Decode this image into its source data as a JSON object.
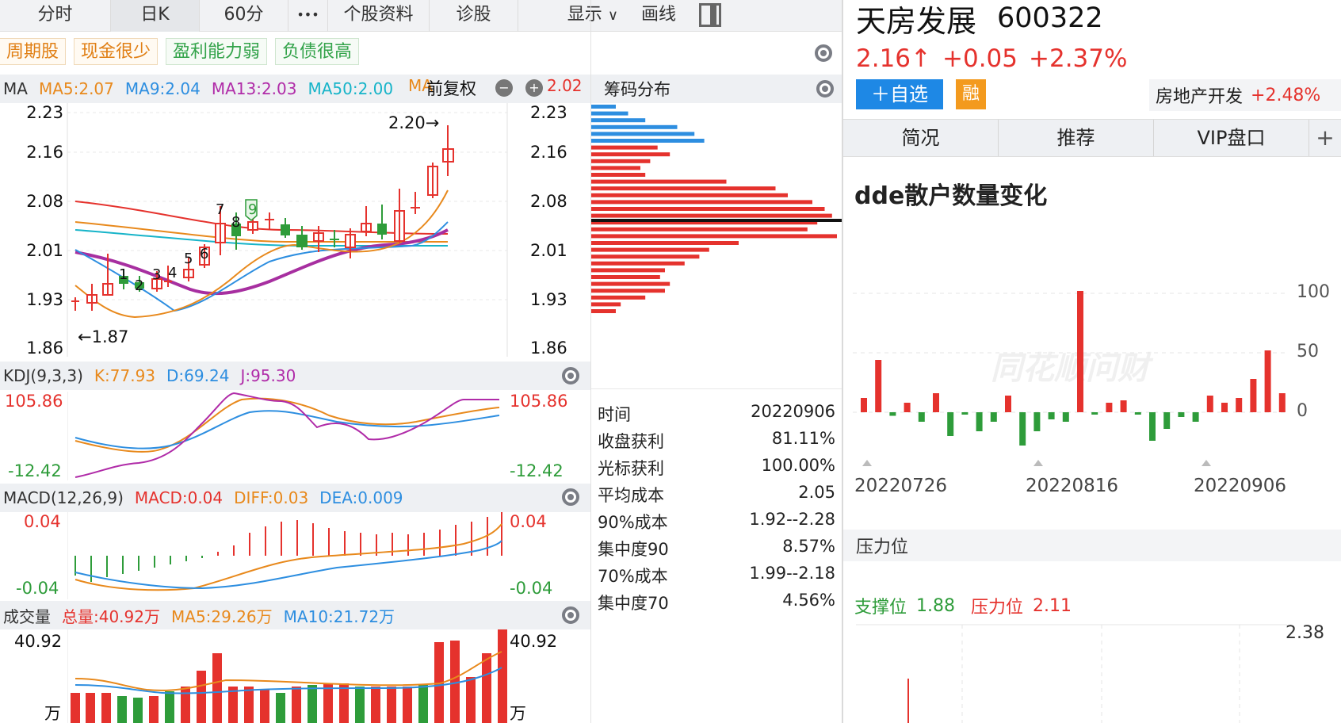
{
  "tabs": [
    {
      "label": "分时"
    },
    {
      "label": "日K"
    },
    {
      "label": "60分"
    },
    {
      "label": "•••"
    },
    {
      "label": "个股资料"
    },
    {
      "label": "诊股"
    },
    {
      "label": "显示"
    },
    {
      "label": "画线"
    }
  ],
  "tags": [
    "周期股",
    "现金很少",
    "盈利能力弱",
    "负债很高"
  ],
  "ma_bar": {
    "title": "MA",
    "ma5": "MA5:2.07",
    "ma9": "MA9:2.04",
    "ma13": "MA13:2.03",
    "ma50": "MA50:2.00",
    "ma_hidden": "MA",
    "fuquan": "前复权",
    "ma_hidden2": "2.02"
  },
  "price_axis": [
    "2.23",
    "2.16",
    "2.08",
    "2.01",
    "1.93",
    "1.86"
  ],
  "kline_labels": {
    "high": "2.20→",
    "low": "←1.87",
    "seq": [
      "1",
      "2",
      "3",
      "4",
      "5",
      "6",
      "7",
      "8",
      "9"
    ]
  },
  "kdj": {
    "title": "KDJ(9,3,3)",
    "k": "K:77.93",
    "d": "D:69.24",
    "j": "J:95.30",
    "top": "105.86",
    "bottom": "-12.42"
  },
  "macd": {
    "title": "MACD(12,26,9)",
    "macd": "MACD:0.04",
    "diff": "DIFF:0.03",
    "dea": "DEA:0.009",
    "top": "0.04",
    "bottom": "-0.04"
  },
  "vol": {
    "title": "成交量",
    "total": "总量:40.92万",
    "ma5": "MA5:29.26万",
    "ma10": "MA10:21.72万",
    "top": "40.92",
    "unit": "万"
  },
  "chip": {
    "title": "筹码分布",
    "rows": [
      {
        "k": "时间",
        "v": "20220906"
      },
      {
        "k": "收盘获利",
        "v": "81.11%"
      },
      {
        "k": "光标获利",
        "v": "100.00%"
      },
      {
        "k": "平均成本",
        "v": "2.05"
      },
      {
        "k": "90%成本",
        "v": "1.92--2.28"
      },
      {
        "k": "集中度90",
        "v": "8.57%"
      },
      {
        "k": "70%成本",
        "v": "1.99--2.18"
      },
      {
        "k": "集中度70",
        "v": "4.56%"
      }
    ],
    "bars": [
      10,
      15,
      22,
      35,
      42,
      46,
      27,
      32,
      24,
      20,
      22,
      55,
      75,
      80,
      90,
      95,
      98,
      92,
      88,
      100,
      60,
      48,
      44,
      38,
      30,
      28,
      32,
      30,
      22,
      12,
      10
    ]
  },
  "stock": {
    "name": "天房发展",
    "code": "600322",
    "price": "2.16↑",
    "change": "+0.05",
    "pct": "+2.37%",
    "add_btn": "＋自选",
    "rong": "融",
    "sector": "房地产开发",
    "sector_pct": "+2.48%"
  },
  "rtabs": [
    {
      "label": "简况"
    },
    {
      "label": "推荐"
    },
    {
      "label": "VIP盘口"
    },
    {
      "label": "+"
    }
  ],
  "dde": {
    "title": "dde散户数量变化",
    "watermark": "同花顺问财",
    "yticks": [
      "100",
      "50",
      "0"
    ],
    "xticks": [
      "20220726",
      "20220816",
      "20220906"
    ],
    "values": [
      12,
      44,
      -3,
      8,
      -8,
      16,
      -20,
      -2,
      -16,
      -8,
      14,
      -28,
      -16,
      -6,
      -8,
      102,
      -2,
      8,
      10,
      -2,
      -24,
      -14,
      -4,
      -8,
      14,
      8,
      12,
      28,
      52,
      16
    ]
  },
  "pressure": {
    "title": "压力位",
    "support_label": "支撑位",
    "support": "1.88",
    "pressure_label": "压力位",
    "pressure_val": "2.11",
    "ytick": "2.38"
  },
  "colors": {
    "up": "#e5322d",
    "down": "#2e9c3a",
    "accent": "#1e88e5"
  }
}
